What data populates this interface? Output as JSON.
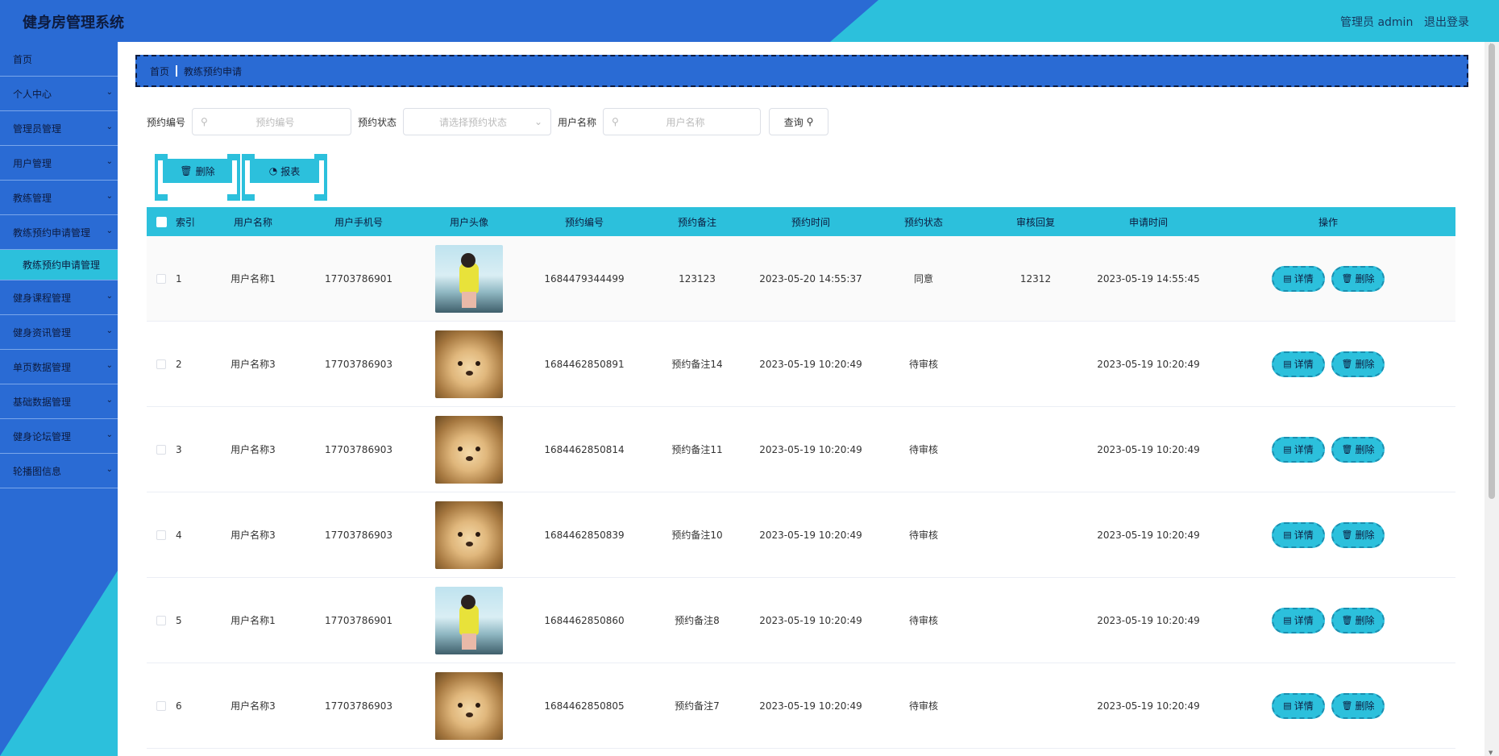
{
  "header": {
    "title": "健身房管理系统",
    "user": "管理员 admin",
    "logout": "退出登录"
  },
  "sidebar": {
    "items": [
      {
        "label": "首页",
        "chevron": false
      },
      {
        "label": "个人中心",
        "chevron": true
      },
      {
        "label": "管理员管理",
        "chevron": true
      },
      {
        "label": "用户管理",
        "chevron": true
      },
      {
        "label": "教练管理",
        "chevron": true
      },
      {
        "label": "教练预约申请管理",
        "chevron": true
      },
      {
        "label": "教练预约申请管理",
        "chevron": false,
        "sub": true
      },
      {
        "label": "健身课程管理",
        "chevron": true
      },
      {
        "label": "健身资讯管理",
        "chevron": true
      },
      {
        "label": "单页数据管理",
        "chevron": true
      },
      {
        "label": "基础数据管理",
        "chevron": true
      },
      {
        "label": "健身论坛管理",
        "chevron": true
      },
      {
        "label": "轮播图信息",
        "chevron": true
      }
    ]
  },
  "breadcrumb": {
    "home": "首页",
    "current": "教练预约申请"
  },
  "search": {
    "booking_no_label": "预约编号",
    "booking_no_placeholder": "预约编号",
    "status_label": "预约状态",
    "status_placeholder": "请选择预约状态",
    "username_label": "用户名称",
    "username_placeholder": "用户名称",
    "query_label": "查询"
  },
  "actions": {
    "delete_label": "删除",
    "report_label": "报表"
  },
  "table": {
    "headers": [
      "索引",
      "用户名称",
      "用户手机号",
      "用户头像",
      "预约编号",
      "预约备注",
      "预约时间",
      "预约状态",
      "审核回复",
      "申请时间",
      "操作"
    ],
    "detail_label": "详情",
    "delete_label": "删除",
    "rows": [
      {
        "index": "1",
        "username": "用户名称1",
        "phone": "17703786901",
        "avatar": "girl",
        "booking_no": "1684479344499",
        "note": "123123",
        "booking_time": "2023-05-20 14:55:37",
        "status": "同意",
        "reply": "12312",
        "apply_time": "2023-05-19 14:55:45"
      },
      {
        "index": "2",
        "username": "用户名称3",
        "phone": "17703786903",
        "avatar": "dog",
        "booking_no": "1684462850891",
        "note": "预约备注14",
        "booking_time": "2023-05-19 10:20:49",
        "status": "待审核",
        "reply": "",
        "apply_time": "2023-05-19 10:20:49"
      },
      {
        "index": "3",
        "username": "用户名称3",
        "phone": "17703786903",
        "avatar": "dog",
        "booking_no": "1684462850814",
        "note": "预约备注11",
        "booking_time": "2023-05-19 10:20:49",
        "status": "待审核",
        "reply": "",
        "apply_time": "2023-05-19 10:20:49"
      },
      {
        "index": "4",
        "username": "用户名称3",
        "phone": "17703786903",
        "avatar": "dog",
        "booking_no": "1684462850839",
        "note": "预约备注10",
        "booking_time": "2023-05-19 10:20:49",
        "status": "待审核",
        "reply": "",
        "apply_time": "2023-05-19 10:20:49"
      },
      {
        "index": "5",
        "username": "用户名称1",
        "phone": "17703786901",
        "avatar": "girl",
        "booking_no": "1684462850860",
        "note": "预约备注8",
        "booking_time": "2023-05-19 10:20:49",
        "status": "待审核",
        "reply": "",
        "apply_time": "2023-05-19 10:20:49"
      },
      {
        "index": "6",
        "username": "用户名称3",
        "phone": "17703786903",
        "avatar": "dog",
        "booking_no": "1684462850805",
        "note": "预约备注7",
        "booking_time": "2023-05-19 10:20:49",
        "status": "待审核",
        "reply": "",
        "apply_time": "2023-05-19 10:20:49"
      }
    ]
  },
  "colors": {
    "primary_blue": "#2a6bd4",
    "accent_cyan": "#2cc0dc",
    "text_dark": "#0d1b3e"
  }
}
